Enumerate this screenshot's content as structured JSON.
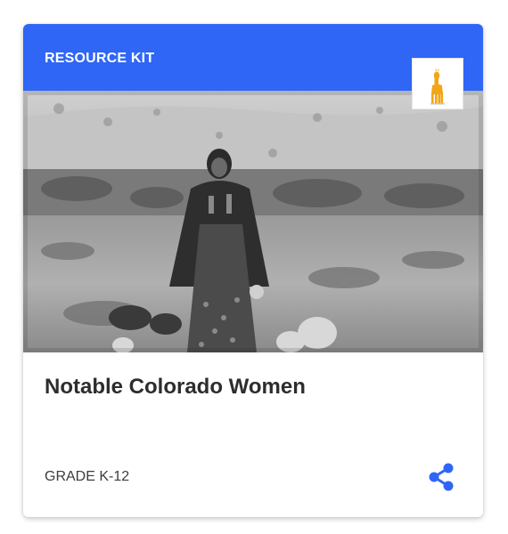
{
  "card": {
    "kit_label": "RESOURCE KIT",
    "title": "Notable Colorado Women",
    "grade": "GRADE K-12"
  },
  "icons": {
    "logo": "camel-logo-icon",
    "share": "share-icon"
  },
  "colors": {
    "header": "#2f66f6",
    "share_icon": "#2f66f6",
    "logo_figure": "#f2a516"
  }
}
